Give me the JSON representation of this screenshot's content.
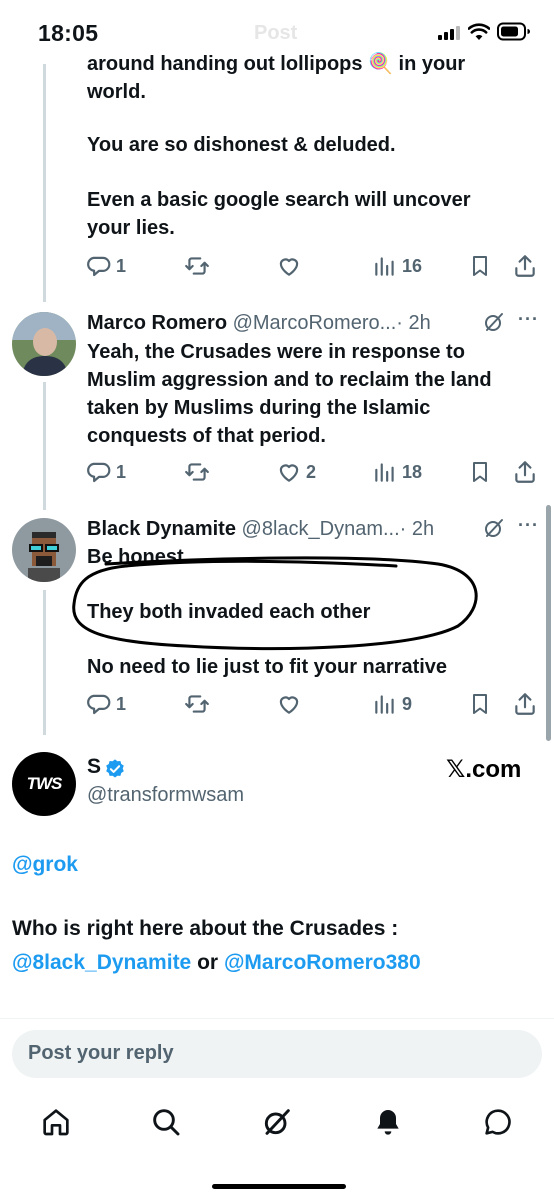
{
  "status_bar": {
    "time": "18:05",
    "faded_title": "Post"
  },
  "tweet1": {
    "lines": [
      "around handing out lollipops 🍭 in your",
      "world.",
      "",
      "You are so dishonest & deluded.",
      "",
      "Even a basic google search will uncover",
      "your lies."
    ],
    "reply_count": "1",
    "views": "16"
  },
  "tweet2": {
    "name": "Marco Romero",
    "handle": "@MarcoRomero...",
    "time": "· 2h",
    "lines": [
      "Yeah, the Crusades were in response to",
      "Muslim aggression and to reclaim the land",
      "taken by Muslims during the Islamic",
      "conquests of that period."
    ],
    "reply_count": "1",
    "like_count": "2",
    "views": "18"
  },
  "tweet3": {
    "name": "Black Dynamite",
    "handle": "@8lack_Dynam...",
    "time": "· 2h",
    "lines": [
      "Be honest",
      "They both invaded each other",
      "No need to lie just to fit your narrative"
    ],
    "reply_count": "1",
    "views": "9"
  },
  "quoted_card": {
    "name": "S",
    "handle": "@transformwsam",
    "avatar_text": "TWS",
    "source": "𝕏.com",
    "mention": "@grok",
    "question": "Who is right here about the Crusades :",
    "mention_a": "@8lack_Dynamite",
    "connector": "or",
    "mention_b": "@MarcoRomero380"
  },
  "reply_bar": {
    "placeholder": "Post your reply"
  },
  "tabbar": {
    "items": [
      "home-icon",
      "search-icon",
      "grok-icon",
      "notifications-icon",
      "messages-icon"
    ]
  },
  "colors": {
    "accent": "#1d9bf0",
    "muted": "#536471",
    "text": "#0f1419"
  }
}
